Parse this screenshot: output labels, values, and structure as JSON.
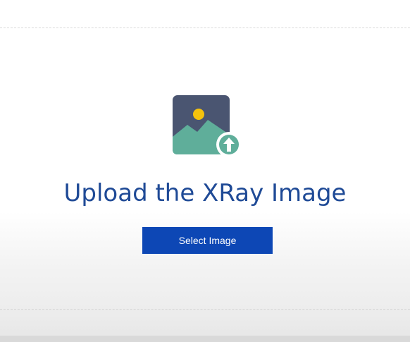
{
  "upload": {
    "title": "Upload the XRay Image",
    "button_label": "Select Image",
    "icon": "image-upload-icon"
  },
  "colors": {
    "title": "#1f4a96",
    "button_bg": "#0d47b5",
    "button_text": "#ffffff",
    "icon_frame": "#4a5571",
    "icon_sun": "#f4c20d",
    "icon_mountain": "#5fae9a",
    "icon_arrow_badge": "#5fae9a"
  }
}
